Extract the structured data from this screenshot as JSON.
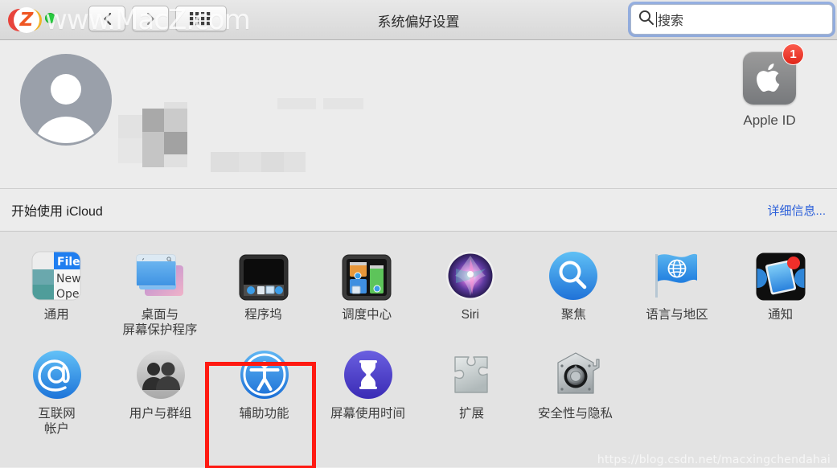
{
  "window": {
    "title": "系统偏好设置",
    "traffic_lights": [
      "close-red",
      "minimize-yellow",
      "zoom-green"
    ],
    "toolbar": {
      "back_label": "back-arrow",
      "forward_label": "forward-arrow",
      "showall_label": "show-all-grid"
    }
  },
  "search": {
    "placeholder": "搜索",
    "value": "",
    "icon": "search-icon",
    "focused": true
  },
  "account": {
    "avatar_icon": "default-user-avatar",
    "name_redacted": true,
    "apple_id": {
      "label": "Apple ID",
      "icon": "apple-logo-icon",
      "badge_count": "1",
      "badge_color": "#e0271a"
    }
  },
  "icloud_banner": {
    "text": "开始使用 iCloud",
    "link_text": "详细信息...",
    "link_color": "#2b5fd9"
  },
  "watermarks": {
    "top_text": "www.MacZ.com",
    "top_logo_letter": "Z",
    "bottom_url": "https://blog.csdn.net/macxingchendahai"
  },
  "highlight": {
    "target": "辅助功能",
    "color": "#ff1a12"
  },
  "grid": {
    "rows": [
      {
        "items": [
          {
            "label": "通用",
            "icon": "general-icon",
            "menu_words": [
              "File",
              "New",
              "Open"
            ]
          },
          {
            "label": "桌面与\n屏幕保护程序",
            "icon": "desktop-screensaver-icon"
          },
          {
            "label": "程序坞",
            "icon": "dock-icon"
          },
          {
            "label": "调度中心",
            "icon": "mission-control-icon"
          },
          {
            "label": "Siri",
            "icon": "siri-icon"
          },
          {
            "label": "聚焦",
            "icon": "spotlight-icon"
          },
          {
            "label": "语言与地区",
            "icon": "language-region-icon"
          },
          {
            "label": "通知",
            "icon": "notifications-icon"
          }
        ]
      },
      {
        "items": [
          {
            "label": "互联网\n帐户",
            "icon": "internet-accounts-icon"
          },
          {
            "label": "用户与群组",
            "icon": "users-groups-icon"
          },
          {
            "label": "辅助功能",
            "icon": "accessibility-icon",
            "highlighted": true
          },
          {
            "label": "屏幕使用时间",
            "icon": "screen-time-icon"
          },
          {
            "label": "扩展",
            "icon": "extensions-icon"
          },
          {
            "label": "安全性与隐私",
            "icon": "security-privacy-icon"
          }
        ]
      }
    ]
  }
}
